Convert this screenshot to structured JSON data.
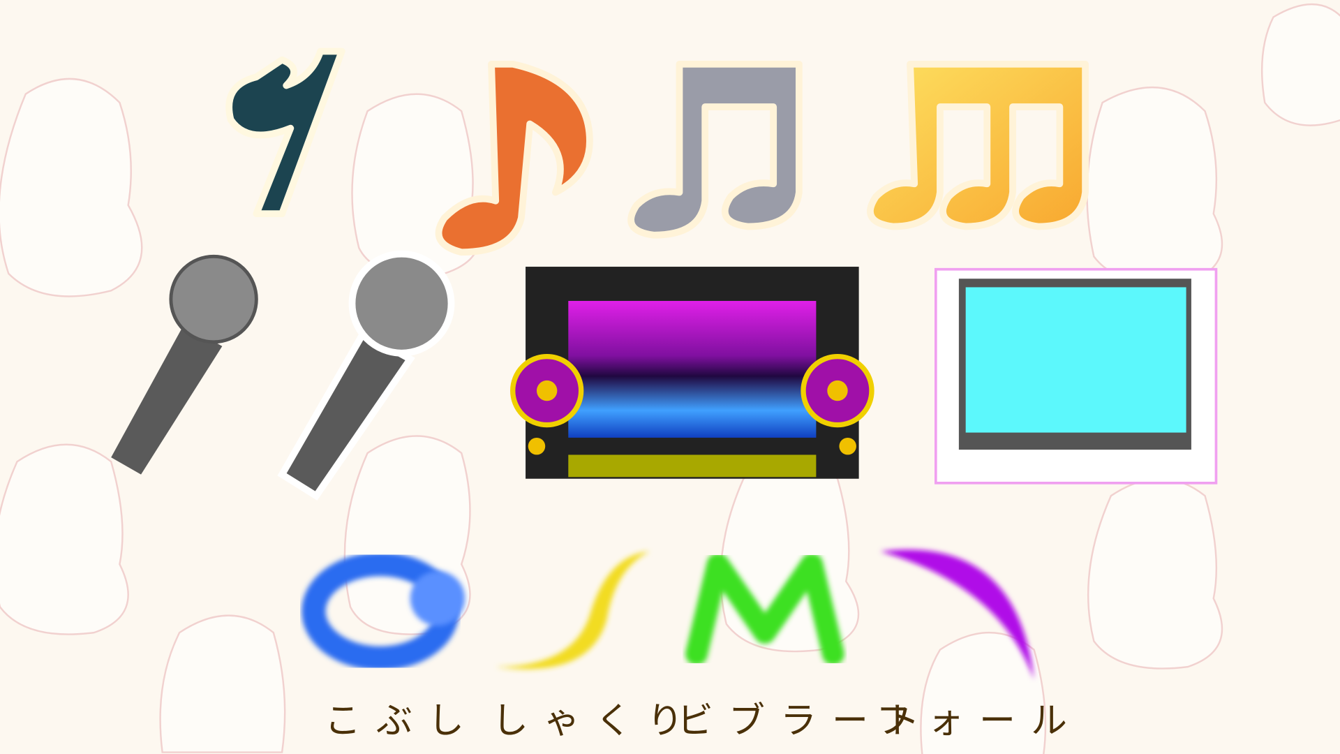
{
  "labels": {
    "kobushi": "こぶし",
    "shakuri": "しゃくり",
    "vibrato": "ビブラート",
    "fall": "フォール"
  },
  "colors": {
    "background": "#fdf8f0",
    "label_text": "#4a3008",
    "kobushi_blue": "#2a6cf0",
    "shakuri_yellow": "#f2dc20",
    "vibrato_green": "#3ee020",
    "fall_purple": "#b010e8",
    "tablet_screen": "#5cf8fc"
  }
}
